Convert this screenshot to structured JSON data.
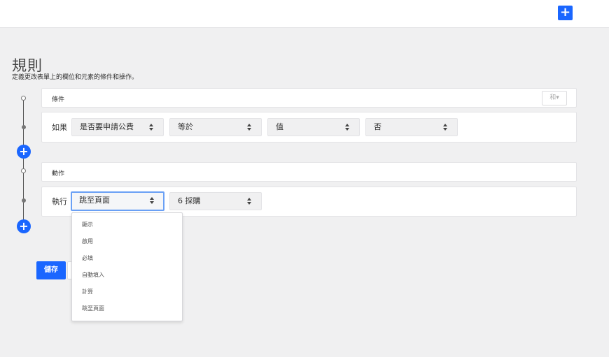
{
  "header": {
    "add_icon": "plus-icon",
    "accent_color": "#1a66ff"
  },
  "page": {
    "title": "規則",
    "subtitle": "定義更改表單上的欄位和元素的條件和操作。"
  },
  "conditions": {
    "section_label": "條件",
    "and_button_label": "和▾",
    "row": {
      "label": "如果",
      "field_value": "是否要申請公費",
      "operator_value": "等於",
      "type_value": "值",
      "compare_value": "否"
    }
  },
  "actions": {
    "section_label": "動作",
    "row": {
      "label": "執行",
      "action_value": "跳至頁面",
      "target_value": "6 採購"
    },
    "dropdown_options": [
      "顯示",
      "啟用",
      "必填",
      "自動填入",
      "計算",
      "跳至頁面"
    ]
  },
  "footer": {
    "save_label": "儲存"
  }
}
